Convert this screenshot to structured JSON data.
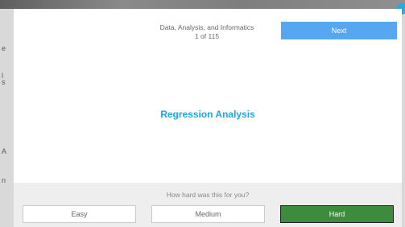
{
  "header": {
    "deck_title": "Data, Analysis, and Informatics",
    "progress": "1 of 115",
    "next_label": "Next"
  },
  "card": {
    "term": "Regression Analysis"
  },
  "rating": {
    "prompt": "How hard was this for you?",
    "easy_label": "Easy",
    "medium_label": "Medium",
    "hard_label": "Hard"
  },
  "colors": {
    "next_button": "#57a6f1",
    "term_text": "#1ba8e3",
    "hard_button": "#3d8b3d",
    "rating_panel": "#eeeeee"
  }
}
